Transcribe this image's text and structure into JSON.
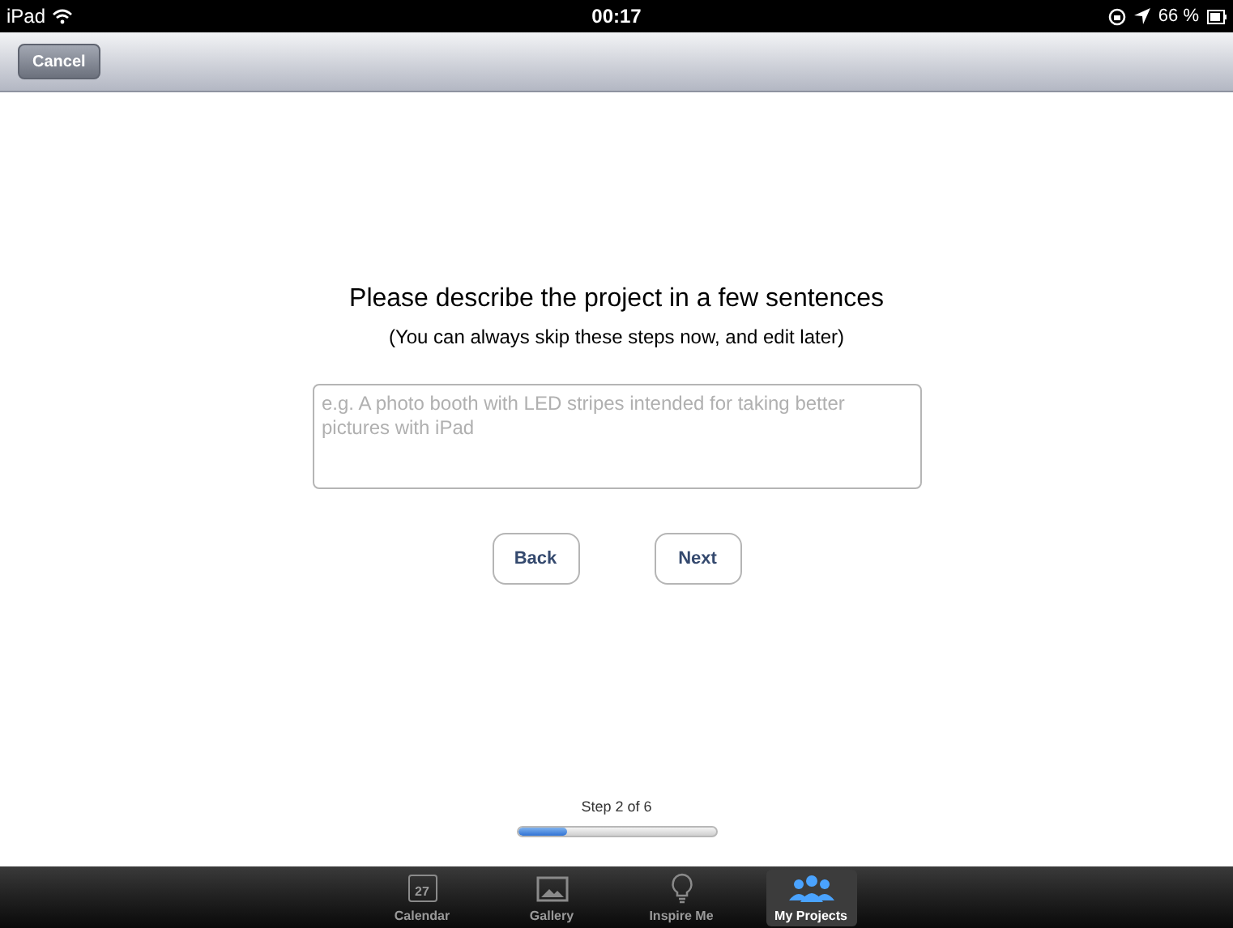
{
  "status_bar": {
    "device": "iPad",
    "time": "00:17",
    "battery": "66 %"
  },
  "nav_bar": {
    "cancel": "Cancel"
  },
  "prompt": {
    "title": "Please describe the project in a few sentences",
    "subtitle": "(You can always skip these steps now, and edit later)"
  },
  "description_field": {
    "placeholder": "e.g. A photo booth with LED stripes intended for taking better pictures with iPad"
  },
  "buttons": [
    "Back",
    "Next"
  ],
  "progress": {
    "label": "Step 2 of 6",
    "level": 0.25
  },
  "tab_bar": [
    {
      "kind": "calendar",
      "label": "Calendar",
      "day": "27",
      "selected": false
    },
    {
      "kind": "gallery",
      "label": "Gallery",
      "selected": false
    },
    {
      "kind": "inspire",
      "label": "Inspire Me",
      "selected": false
    },
    {
      "kind": "projects",
      "label": "My Projects",
      "selected": true
    }
  ]
}
